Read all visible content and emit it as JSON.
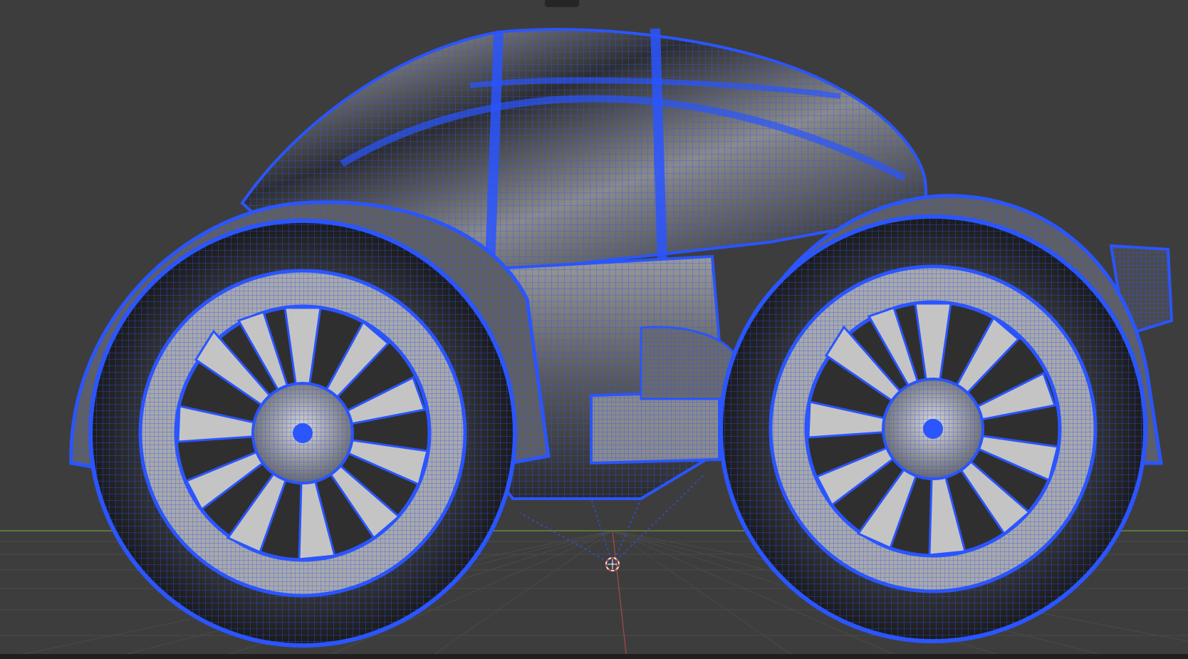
{
  "viewport": {
    "mode": "wireframe-overlay",
    "background_color": "#3d3d3d",
    "grid_color": "#4a4a4a",
    "axis_x_color": "#6b8a3a",
    "axis_y_color": "#a84a4a",
    "wire_color": "#2a55ff",
    "shell_color": "#8c8c8c",
    "object": {
      "type": "car-mesh",
      "selected": true
    },
    "origin_icon": "origin-marker-icon",
    "header_icon": "viewport-shading-icon"
  }
}
